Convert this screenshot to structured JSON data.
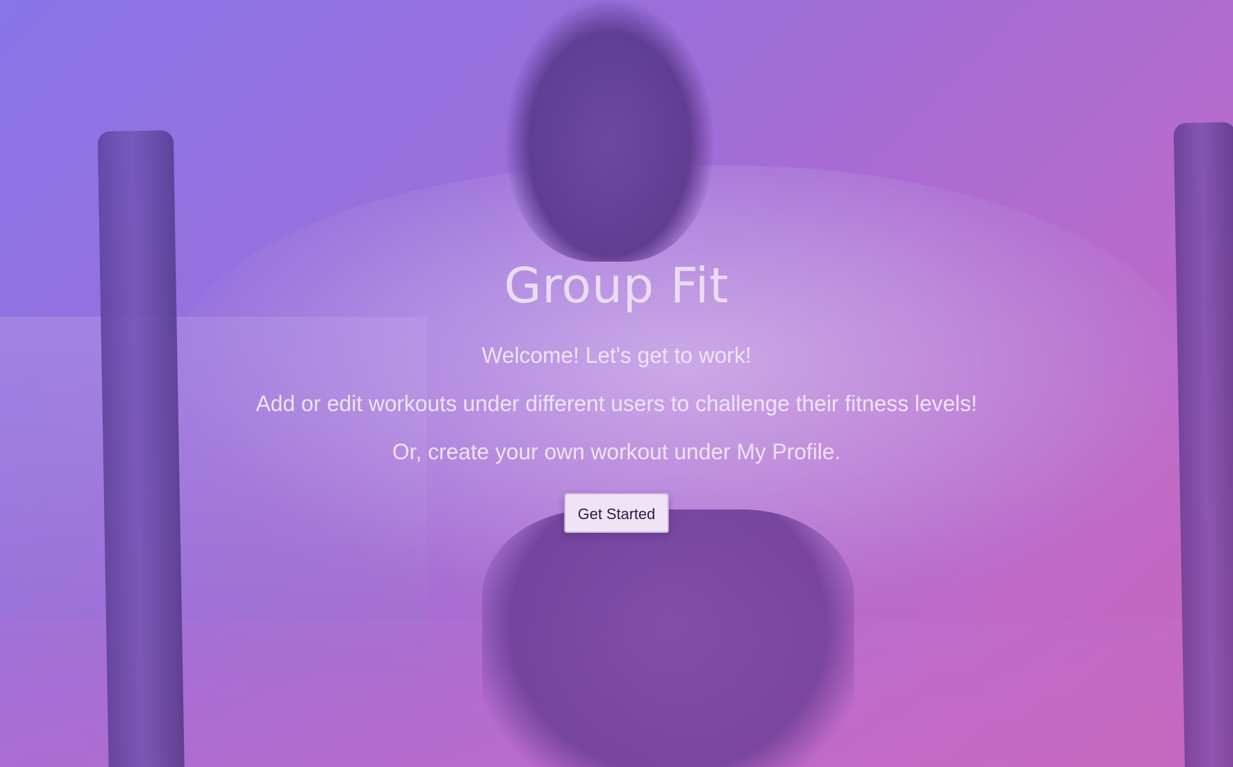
{
  "hero": {
    "title": "Group Fit",
    "welcome": "Welcome! Let's get to work!",
    "description": "Add or edit workouts under different users to challenge their fitness levels!",
    "profile_note": "Or, create your own workout under My Profile.",
    "cta_label": "Get Started"
  },
  "colors": {
    "overlay_start": "#8b79e6",
    "overlay_end": "#c469b9",
    "text": "#eadcf5",
    "button_bg": "#efe4f6",
    "button_text": "#2a1c3e"
  }
}
